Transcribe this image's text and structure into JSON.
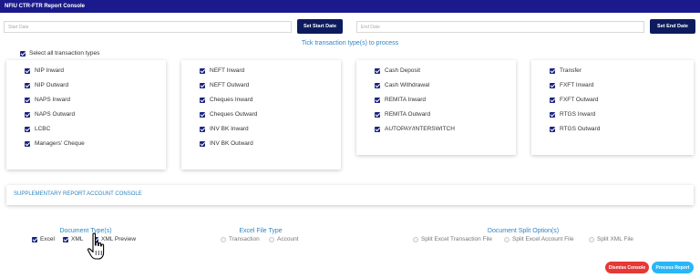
{
  "app": {
    "title": "NFIU CTR-FTR Report Console"
  },
  "dates": {
    "start_placeholder": "Start Date",
    "start_button": "Set Start Date",
    "end_placeholder": "End Date",
    "end_button": "Set End Date"
  },
  "instruction": "Tick transaction type(s) to process",
  "select_all": {
    "label": "Select all transaction types",
    "checked": true
  },
  "transaction_groups": [
    {
      "items": [
        "NIP Inward",
        "NIP Outward",
        "NAPS Inward",
        "NAPS Outward",
        "LCBC",
        "Managers' Cheque"
      ]
    },
    {
      "items": [
        "NEFT Inward",
        "NEFT Outward",
        "Cheques Inward",
        "Cheques Outward",
        "INV BK Inward",
        "INV BK Outward"
      ]
    },
    {
      "items": [
        "Cash Deposit",
        "Cash Withdrawal",
        "REMITA Inward",
        "REMITA Outward",
        "AUTOPAY/INTERSWITCH"
      ]
    },
    {
      "items": [
        "Transfer",
        "FXFT Inward",
        "FXFT Outward",
        "RTGS Inward",
        "RTGS Outward"
      ]
    }
  ],
  "supplementary": {
    "title": "SUPPLEMENTARY REPORT ACCOUNT CONSOLE"
  },
  "document_types": {
    "title": "Document Type(s)",
    "options": [
      {
        "label": "Excel",
        "checked": true
      },
      {
        "label": "XML",
        "checked": true
      },
      {
        "label": "XML Preview",
        "checked": true
      }
    ]
  },
  "excel_file_type": {
    "title": "Excel File Type",
    "options": [
      {
        "label": "Transaction"
      },
      {
        "label": "Account"
      }
    ]
  },
  "split_options": {
    "title": "Document Split Option(s)",
    "options": [
      {
        "label": "Split Excel Transaction File"
      },
      {
        "label": "Split Excel Account File"
      },
      {
        "label": "Split XML File"
      }
    ]
  },
  "actions": {
    "dismiss_label": "Dismiss Console",
    "process_label": "Process Report"
  },
  "colors": {
    "titlebar": "#1a1a8c",
    "button_dark": "#0d1b5e",
    "accent_text": "#2e86c1",
    "dismiss": "#e53935",
    "process": "#29b6f6"
  }
}
